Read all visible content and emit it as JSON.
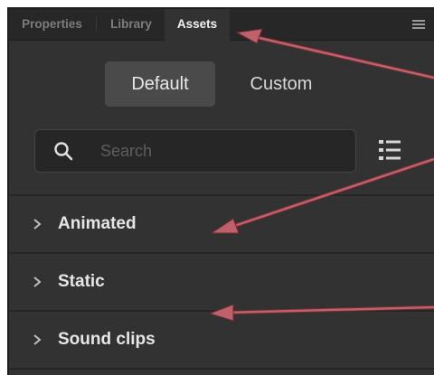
{
  "tabs": [
    {
      "label": "Properties",
      "active": false
    },
    {
      "label": "Library",
      "active": false
    },
    {
      "label": "Assets",
      "active": true
    }
  ],
  "panel_menu_icon": "hamburger-menu-icon",
  "segments": [
    {
      "label": "Default",
      "active": true
    },
    {
      "label": "Custom",
      "active": false
    }
  ],
  "search": {
    "placeholder": "Search",
    "value": "",
    "icon": "search-icon"
  },
  "list_view_icon": "list-view-icon",
  "categories": [
    {
      "label": "Animated",
      "icon": "chevron-right-icon"
    },
    {
      "label": "Static",
      "icon": "chevron-right-icon"
    },
    {
      "label": "Sound clips",
      "icon": "chevron-right-icon"
    }
  ],
  "colors": {
    "panel_bg": "#323232",
    "tabbar_bg": "#272727",
    "annotation_arrow": "#c0606a"
  }
}
